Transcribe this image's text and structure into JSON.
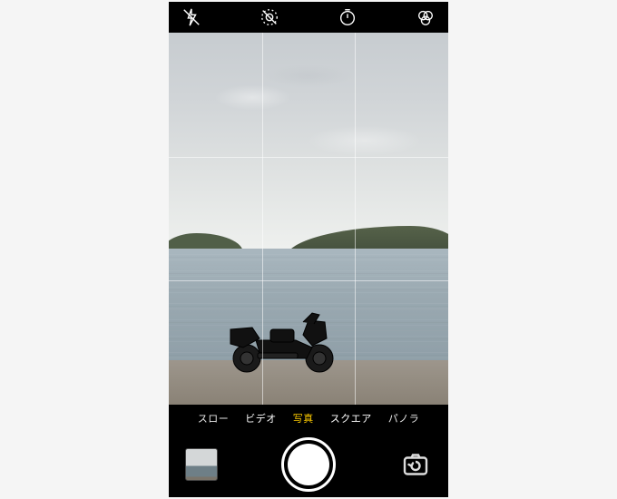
{
  "topbar": {
    "flash_icon": "flash-off-icon",
    "live_icon": "live-photo-off-icon",
    "timer_icon": "timer-icon",
    "filters_icon": "filters-icon"
  },
  "modes": {
    "items": [
      "スロー",
      "ビデオ",
      "写真",
      "スクエア",
      "パノラマ"
    ],
    "active_index": 2,
    "visible_last_truncated": "パノラ"
  },
  "bottombar": {
    "thumbnail_label": "last-photo-thumbnail",
    "shutter_label": "shutter-button",
    "flip_label": "camera-flip-button"
  },
  "colors": {
    "active_mode": "#ffcc00",
    "background": "#000000"
  }
}
